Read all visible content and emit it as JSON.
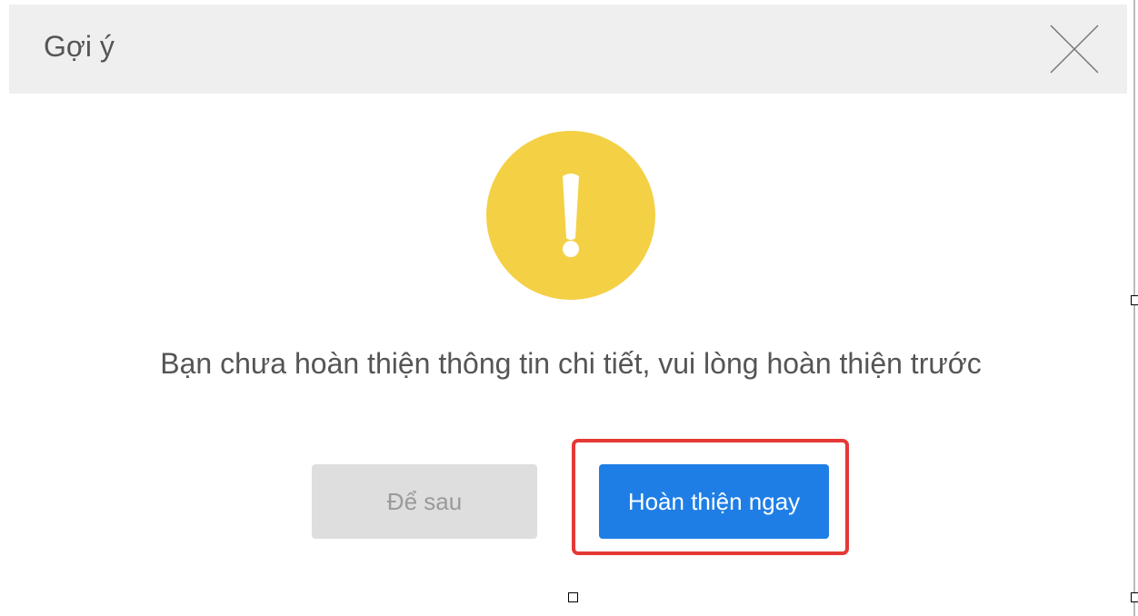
{
  "dialog": {
    "title": "Gợi ý",
    "close_icon": "close-icon",
    "warning_icon": "exclamation-circle-icon",
    "warning_color": "#f4d045",
    "message": "Bạn chưa hoàn thiện thông tin chi tiết, vui lòng hoàn thiện trước",
    "later_label": "Để sau",
    "complete_label": "Hoàn thiện ngay",
    "primary_color": "#1f7ee6",
    "highlight_color": "#e53935"
  }
}
